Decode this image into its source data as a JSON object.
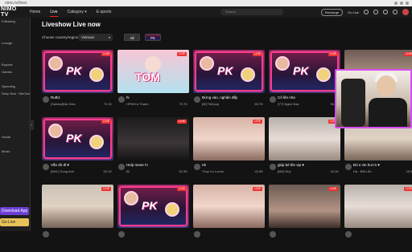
{
  "browser": {
    "url": "nimo.tv/lives"
  },
  "nav": {
    "logo": "NIMO TV",
    "links": [
      "Home",
      "Live",
      "Category ▾",
      "E-sports"
    ],
    "search_placeholder": "Search",
    "recharge": "Recharge",
    "golive": "Go Live"
  },
  "sidebar": {
    "items": [
      "Following",
      "",
      "",
      "Lounge",
      "",
      "",
      "Esports",
      "Games",
      "",
      "Spending",
      "Deep Sea · WeChat",
      "",
      "",
      "",
      "",
      "",
      "Social",
      "",
      "Music",
      "",
      ""
    ],
    "download": "Download App",
    "live": "Go Live"
  },
  "main": {
    "title": "Liveshow Live now",
    "filter_label": "Choose country/region:",
    "country": "Vietnam",
    "pills": [
      "All",
      "PK"
    ]
  },
  "cards": [
    {
      "cap": "Ruthz",
      "host": "[Salsiso]Đài Giáo",
      "views": "70.1K",
      "style": "pk"
    },
    {
      "cap": "hi",
      "host": "HPMH A Thanh",
      "views": "70.7K",
      "style": "tom",
      "overlay": "TOM"
    },
    {
      "cap": "Đừng vào, nghiện đấy",
      "host": "[M] TitiXpop",
      "views": "60.7K",
      "style": "pk"
    },
    {
      "cap": "Cô lên nha",
      "host": "[YT] Ngân Mạc",
      "views": "56.3K",
      "style": "pk"
    },
    {
      "cap": "",
      "host": "",
      "views": "",
      "style": "person"
    },
    {
      "cap": "Vẫn đó đi ♥",
      "host": "[MHL] Song Anh",
      "views": "50.1K",
      "style": "pk"
    },
    {
      "cap": "Help meee !!!",
      "host": "Bỉ",
      "views": "51.9K",
      "style": "person3"
    },
    {
      "cap": "Hii",
      "host": "Thuý Xu Lumm",
      "views": "42.6K",
      "style": "person4"
    },
    {
      "cap": "giúp bé lên vip ♥",
      "host": "[MH] Shy",
      "views": "40.4K",
      "style": "person5"
    },
    {
      "cap": "Đó e vin hut m ♥",
      "host": "Hạ · Biểu Ân",
      "views": "45.5K",
      "style": "person2"
    },
    {
      "cap": "",
      "host": "",
      "views": "",
      "style": "person2"
    },
    {
      "cap": "",
      "host": "",
      "views": "",
      "style": "pk"
    },
    {
      "cap": "",
      "host": "",
      "views": "",
      "style": "person4"
    },
    {
      "cap": "",
      "host": "",
      "views": "",
      "style": "person"
    },
    {
      "cap": "",
      "host": "",
      "views": "",
      "style": "person5"
    }
  ],
  "live_tag": "LIVE",
  "pk_label": "PK"
}
